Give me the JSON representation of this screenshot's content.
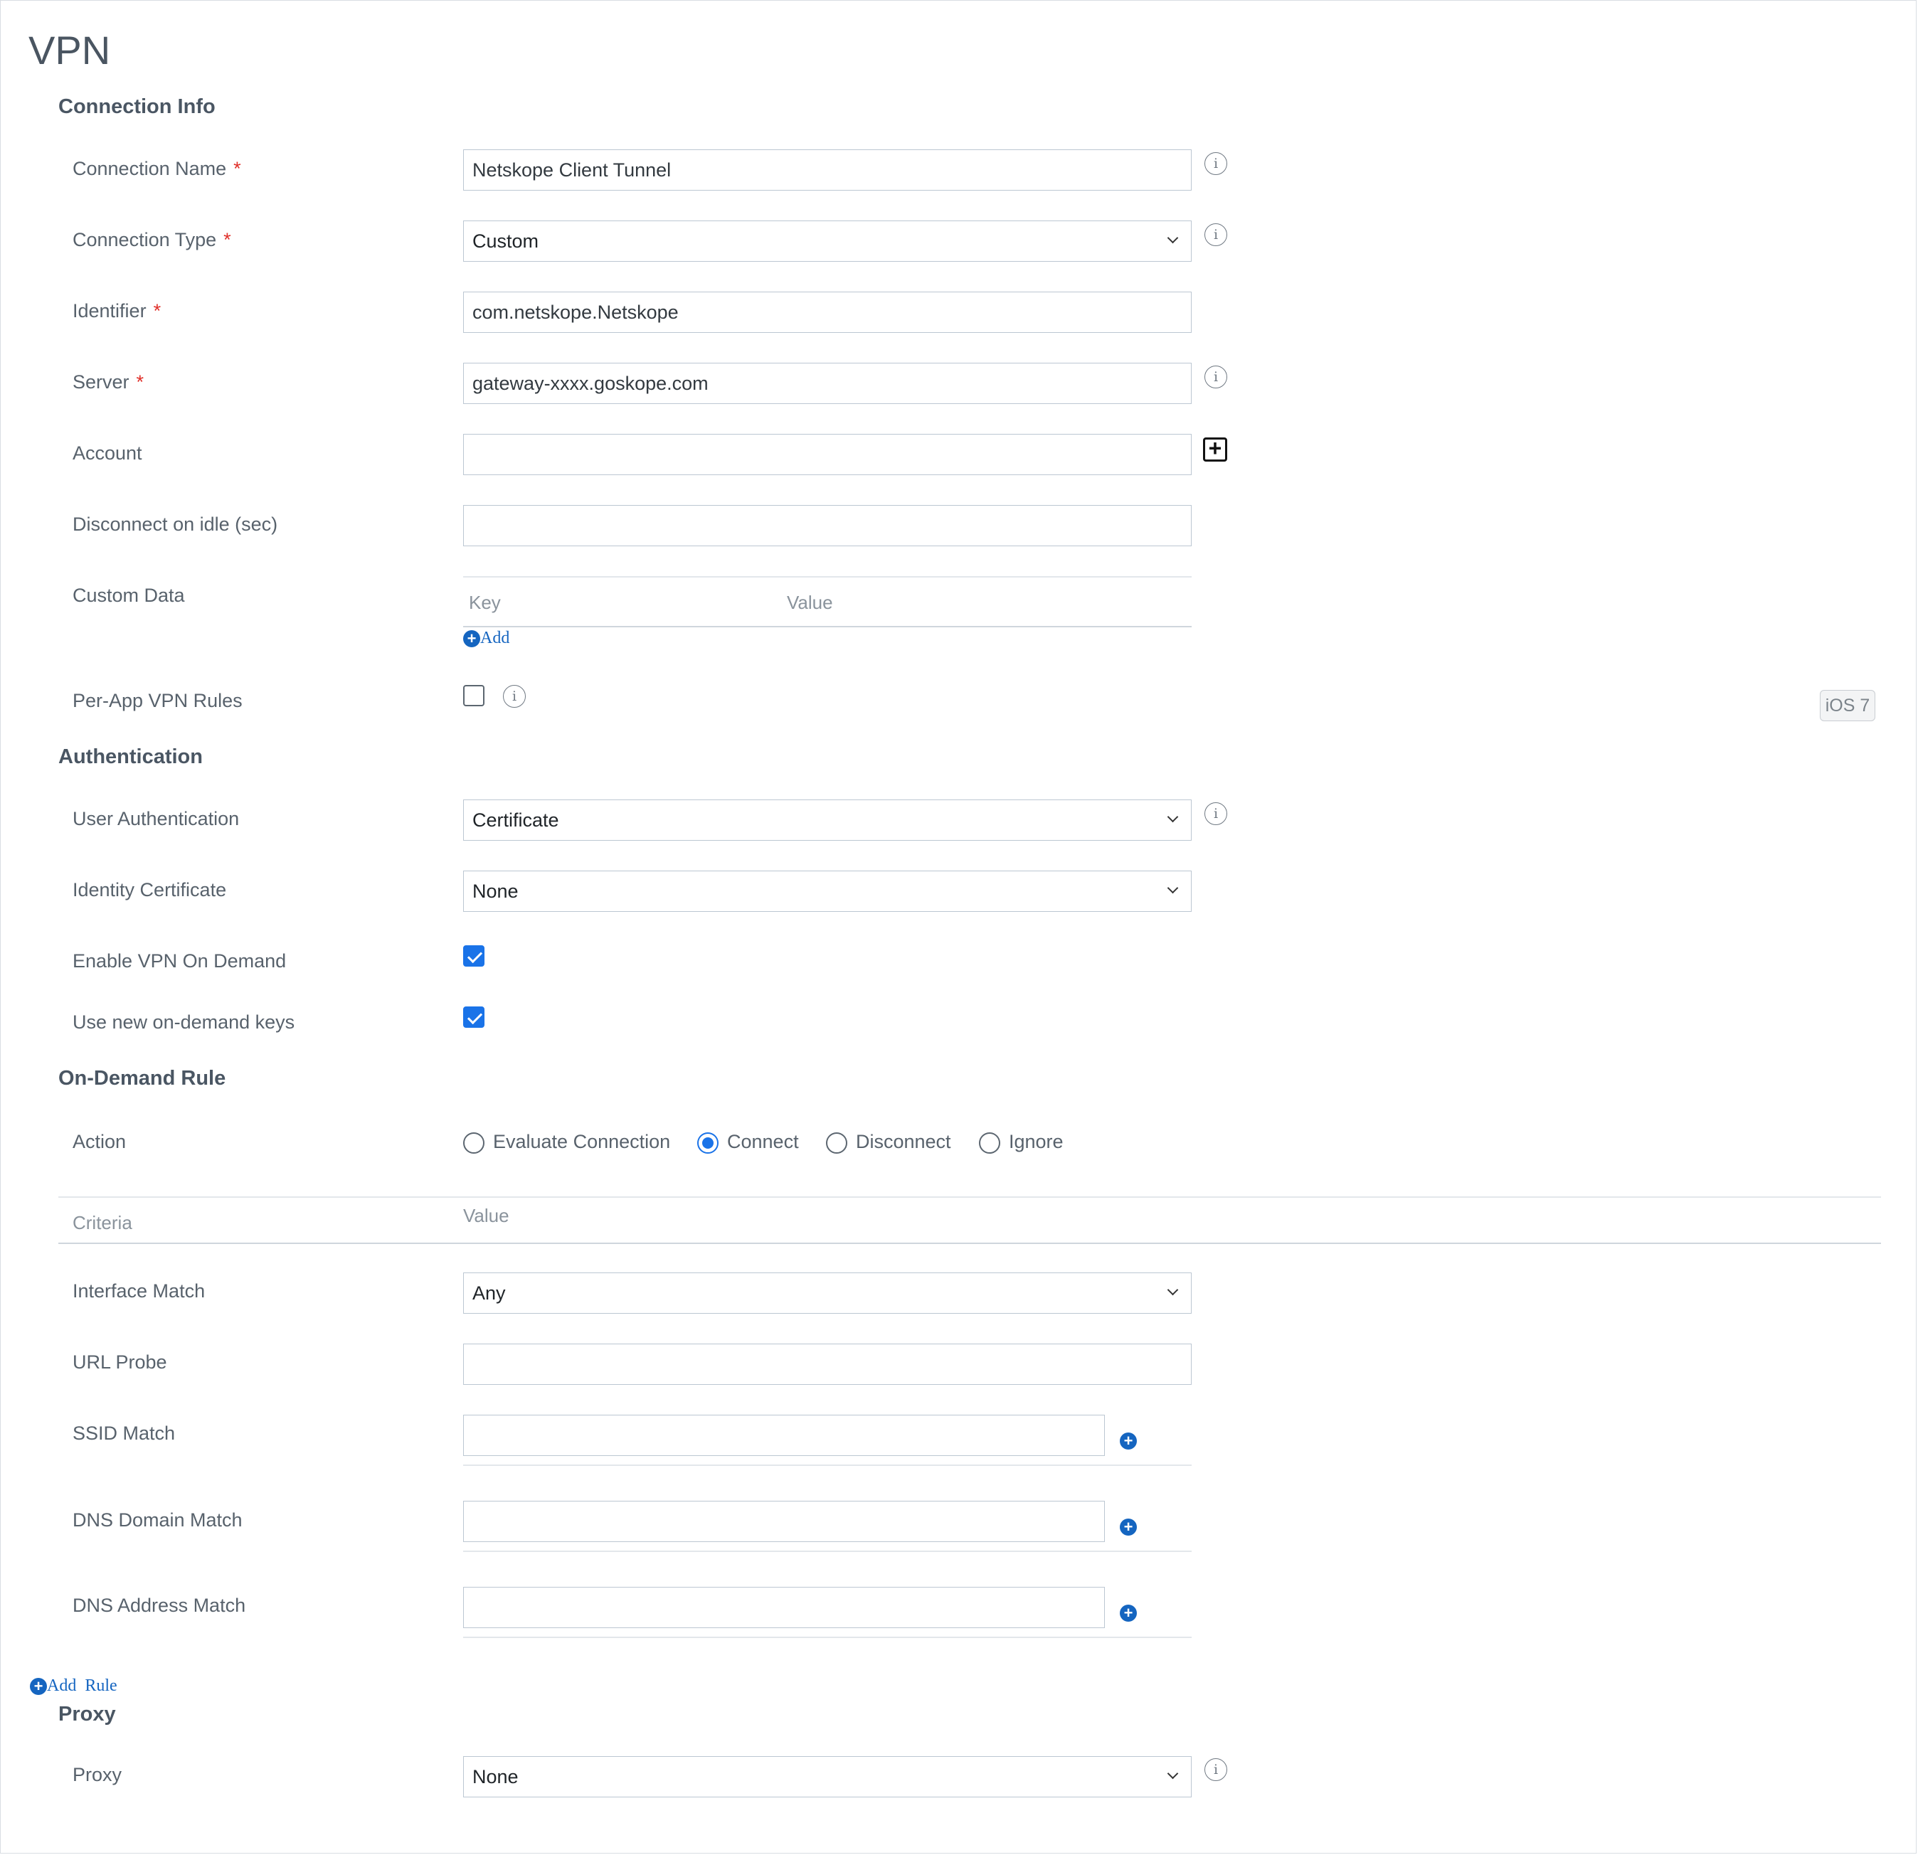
{
  "page": {
    "title": "VPN"
  },
  "sections": {
    "connection_info": "Connection Info",
    "authentication": "Authentication",
    "on_demand_rule": "On-Demand Rule",
    "proxy": "Proxy"
  },
  "connection": {
    "name_label": "Connection Name",
    "name_value": "Netskope Client Tunnel",
    "type_label": "Connection Type",
    "type_value": "Custom",
    "identifier_label": "Identifier",
    "identifier_value": "com.netskope.Netskope",
    "server_label": "Server",
    "server_value": "gateway-xxxx.goskope.com",
    "account_label": "Account",
    "account_value": "",
    "idle_label": "Disconnect on idle (sec)",
    "idle_value": "",
    "custom_data_label": "Custom Data",
    "custom_data_key_header": "Key",
    "custom_data_value_header": "Value",
    "custom_data_add": "Add",
    "per_app_label": "Per-App VPN Rules",
    "per_app_checked": false,
    "ios_badge": "iOS 7",
    "required_mark": "*"
  },
  "authentication": {
    "user_auth_label": "User Authentication",
    "user_auth_value": "Certificate",
    "identity_cert_label": "Identity Certificate",
    "identity_cert_value": "None",
    "vpn_on_demand_label": "Enable VPN On Demand",
    "vpn_on_demand_checked": true,
    "new_keys_label": "Use new on-demand keys",
    "new_keys_checked": true
  },
  "on_demand": {
    "action_label": "Action",
    "actions": [
      {
        "label": "Evaluate Connection",
        "selected": false
      },
      {
        "label": "Connect",
        "selected": true
      },
      {
        "label": "Disconnect",
        "selected": false
      },
      {
        "label": "Ignore",
        "selected": false
      }
    ],
    "criteria_header": "Criteria",
    "value_header": "Value",
    "interface_match_label": "Interface Match",
    "interface_match_value": "Any",
    "url_probe_label": "URL Probe",
    "url_probe_value": "",
    "ssid_match_label": "SSID Match",
    "dns_domain_match_label": "DNS Domain Match",
    "dns_address_match_label": "DNS Address Match",
    "add_rule": "Add  Rule"
  },
  "proxy": {
    "proxy_label": "Proxy",
    "proxy_value": "None"
  },
  "icons": {
    "info": "info-icon",
    "add_box": "plus-square-icon",
    "add_circle": "plus-circle-icon"
  },
  "colors": {
    "accent": "#1a73e8",
    "link": "#1565c0",
    "required": "#e0302a"
  }
}
